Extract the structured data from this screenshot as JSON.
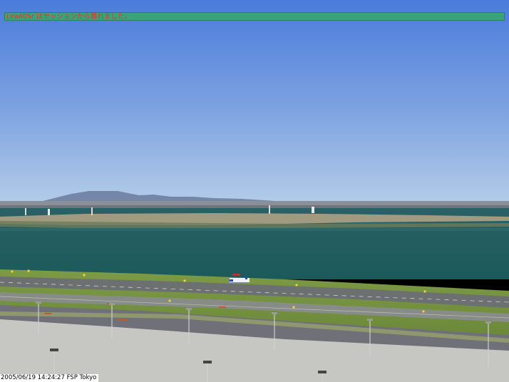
{
  "sim": {
    "message": "Lea40Sr はセッションから離れました。",
    "caption": "2005/06/19 14:24:27 FSP Tokyo"
  },
  "colors": {
    "sky_top": "#4c7edb",
    "sky_horizon": "#a8c6e6",
    "water": "#1f5a5c",
    "grass": "#6e8a3a",
    "tarmac": "#6f6f78",
    "apron": "#c8c8c4",
    "message_bar": "#3aa37c",
    "message_text": "#ff2a1a"
  }
}
